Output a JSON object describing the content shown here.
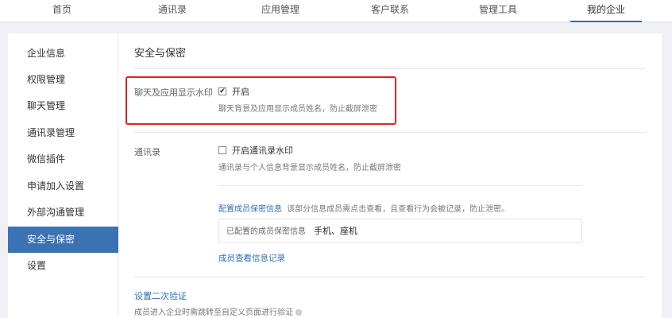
{
  "topnav": {
    "tabs": [
      {
        "label": "首页"
      },
      {
        "label": "通讯录"
      },
      {
        "label": "应用管理"
      },
      {
        "label": "客户联系"
      },
      {
        "label": "管理工具"
      },
      {
        "label": "我的企业"
      }
    ],
    "active": "我的企业"
  },
  "sidebar": {
    "items": [
      {
        "label": "企业信息"
      },
      {
        "label": "权限管理"
      },
      {
        "label": "聊天管理"
      },
      {
        "label": "通讯录管理"
      },
      {
        "label": "微信插件"
      },
      {
        "label": "申请加入设置"
      },
      {
        "label": "外部沟通管理"
      },
      {
        "label": "安全与保密"
      },
      {
        "label": "设置"
      }
    ],
    "active": "安全与保密"
  },
  "main": {
    "title": "安全与保密",
    "chat_watermark": {
      "label": "聊天及应用显示水印",
      "checkbox_label": "开启",
      "checked": true,
      "description": "聊天背景及应用显示成员姓名，防止截屏泄密"
    },
    "contacts": {
      "label": "通讯录",
      "checkbox_label": "开启通讯录水印",
      "checked": false,
      "description": "通讯录与个人信息背景显示成员姓名，防止截屏泄密",
      "config_link": "配置成员保密信息",
      "config_desc": "该部分信息成员需点击查看，且查看行为会被记录，防止泄密。",
      "configured_label": "已配置的成员保密信息",
      "configured_value": "手机、座机",
      "view_log_link": "成员查看信息记录"
    },
    "two_factor": {
      "link": "设置二次验证",
      "description": "成员进入企业时需跳转至自定义页面进行验证"
    }
  },
  "colors": {
    "accent": "#3b72b3",
    "highlight_border": "#d9262b",
    "link": "#2f6fb8"
  }
}
